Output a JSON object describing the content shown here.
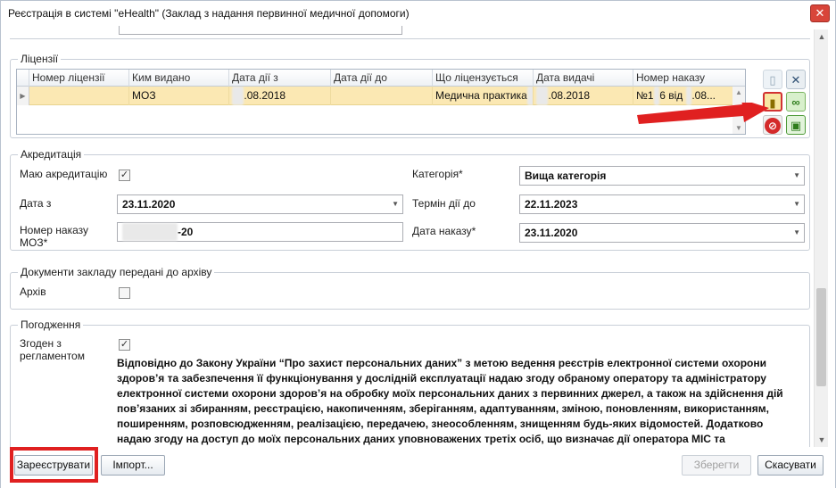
{
  "window": {
    "title": "Реєстрація в системі \"eHealth\" (Заклад з надання первинної медичної допомоги)"
  },
  "licenses": {
    "section_title": "Ліцензії",
    "columns": [
      "Номер ліцензії",
      "Ким видано",
      "Дата дії з",
      "Дата дії до",
      "Що ліцензується",
      "Дата видачі",
      "Номер наказу"
    ],
    "row": {
      "number": "",
      "issued_by": "МОЗ",
      "date_from": ".08.2018",
      "date_to": "",
      "subject": "Медична практика",
      "issue_date": ".08.2018",
      "order_number": "№1",
      "order_number_tail": "6 від",
      "order_date_tail": ".08..."
    }
  },
  "accreditation": {
    "section_title": "Акредитація",
    "has_label": "Маю акредитацію",
    "has_checked": "✓",
    "date_from_label": "Дата з",
    "date_from": "23.11.2020",
    "order_label": "Номер наказу МОЗ*",
    "order_value": "-20",
    "category_label": "Категорія*",
    "category_value": "Вища категорія",
    "term_label": "Термін дії до",
    "term_value": "22.11.2023",
    "order_date_label": "Дата наказу*",
    "order_date_value": "23.11.2020"
  },
  "archive": {
    "section_title": "Документи закладу передані до архіву",
    "label": "Архів",
    "checked": ""
  },
  "consent": {
    "section_title": "Погодження",
    "label": "Згоден з регламентом",
    "checked": "✓",
    "text": "Відповідно до Закону України “Про захист персональних даних” з метою ведення реєстрів електронної системи охорони здоров’я та забезпечення її функціонування у дослідній експлуатації надаю згоду обраному оператору та адміністратору електронної системи охорони здоров’я на обробку моїх персональних даних з первинних джерел, а також на здійснення дій пов’язаних зі збиранням, реєстрацією, накопиченням, зберіганням, адаптуванням, зміною, поновленням, використанням, поширенням, розповсюдженням, реалізацією, передачею, знеособленням, знищенням будь-яких відомостей. Додатково надаю згоду на доступ до моїх персональних даних уповноважених третіх осіб, що визначає дії оператора МІС та адміністратора у разі отримання запиту від уповноваженої третьої особи щодо надання доступу до персональних даних. Підтверджую достовірність"
  },
  "footer": {
    "register": "Зареєструвати",
    "import": "Імпорт...",
    "save": "Зберегти",
    "cancel": "Скасувати"
  },
  "colors": {
    "highlight": "#e02020",
    "selected_row": "#fbe8b3"
  }
}
